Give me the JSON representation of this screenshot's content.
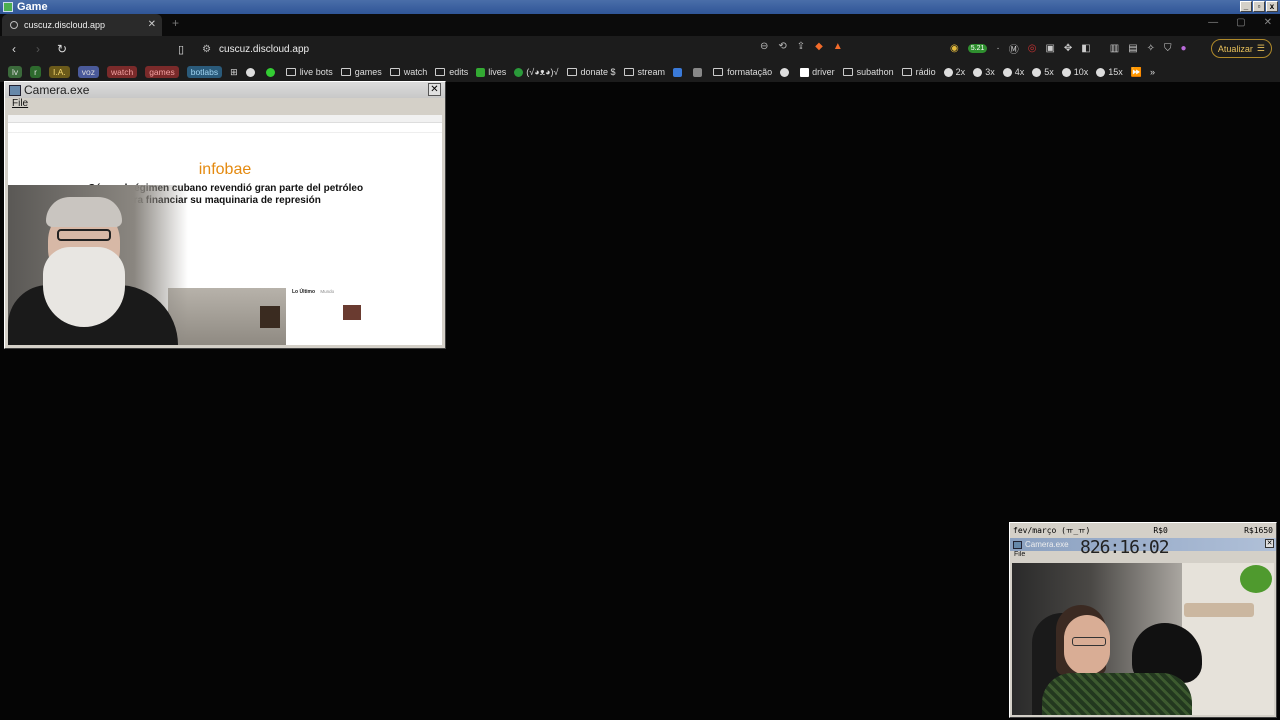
{
  "os": {
    "title": "Game",
    "controls": [
      "_",
      "▫",
      "x"
    ]
  },
  "browser": {
    "tab": {
      "title": "cuscuz.discloud.app"
    },
    "url": "cuscuz.discloud.app",
    "update_button": "Atualizar",
    "extension_badge": "5.21",
    "bookmarks": [
      {
        "label": "lv",
        "kind": "chip",
        "color": "#3b6a3b"
      },
      {
        "label": "r",
        "kind": "chip",
        "color": "#2d6a2d"
      },
      {
        "label": "I.A.",
        "kind": "chip",
        "color": "#6b5a1a"
      },
      {
        "label": "voz",
        "kind": "chip",
        "color": "#4a5a9a"
      },
      {
        "label": "watch",
        "kind": "chip",
        "color": "#7a2a2a"
      },
      {
        "label": "games",
        "kind": "chip",
        "color": "#7a2a2a"
      },
      {
        "label": "botlabs",
        "kind": "chip",
        "color": "#2a5a7a"
      },
      {
        "label": "live bots",
        "kind": "folder"
      },
      {
        "label": "games",
        "kind": "folder"
      },
      {
        "label": "watch",
        "kind": "folder"
      },
      {
        "label": "edits",
        "kind": "folder"
      },
      {
        "label": "lives",
        "kind": "icon"
      },
      {
        "label": "(√◕ᴥ◕)√",
        "kind": "icon"
      },
      {
        "label": "donate $",
        "kind": "folder"
      },
      {
        "label": "stream",
        "kind": "folder"
      },
      {
        "label": "formatação",
        "kind": "folder"
      },
      {
        "label": "driver",
        "kind": "icon"
      },
      {
        "label": "subathon",
        "kind": "folder"
      },
      {
        "label": "rádio",
        "kind": "folder"
      },
      {
        "label": "2x",
        "kind": "icon"
      },
      {
        "label": "3x",
        "kind": "icon"
      },
      {
        "label": "4x",
        "kind": "icon"
      },
      {
        "label": "5x",
        "kind": "icon"
      },
      {
        "label": "10x",
        "kind": "icon"
      },
      {
        "label": "15x",
        "kind": "icon"
      }
    ]
  },
  "camera1": {
    "title": "Camera.exe",
    "menu_file": "File",
    "site": {
      "logo": "infobae",
      "headline": "Cómo el régimen cubano revendió gran parte del petróleo ortado para financiar su maquinaria de represión",
      "latest_heading": "Lo Último",
      "latest_tab": "Mundo"
    }
  },
  "overlay": {
    "period": "fev/março (ㅠ_ㅠ)",
    "goal_current": "R$0",
    "goal_max": "R$1650",
    "camera_title": "Camera.exe",
    "menu_file": "File",
    "timer": "826:16:02"
  }
}
